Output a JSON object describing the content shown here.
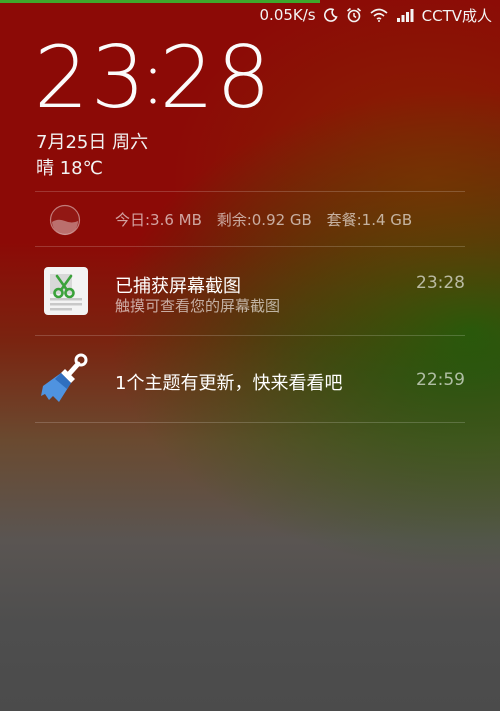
{
  "status_bar": {
    "network_speed": "0.05K/s",
    "moon_icon": "moon-icon",
    "alarm_icon": "alarm-clock-icon",
    "wifi_icon": "wifi-icon",
    "signal_icon": "signal-bars-icon",
    "carrier": "CCTV成人"
  },
  "lock_screen": {
    "clock_hours": "23",
    "clock_minutes": "28",
    "date": "7月25日 周六",
    "weather": "晴 18℃"
  },
  "memory": {
    "today_label": "今日:3.6 MB",
    "remaining_label": "剩余:0.92 GB",
    "plan_label": "套餐:1.4 GB",
    "gauge_icon": "data-usage-gauge-icon"
  },
  "notifications": [
    {
      "title": "已捕获屏幕截图",
      "subtitle": "触摸可查看您的屏幕截图",
      "time": "23:28",
      "icon": "screenshot-scissors-icon"
    },
    {
      "title": "1个主题有更新，快来看看吧",
      "time": "22:59",
      "icon": "theme-brush-icon"
    }
  ],
  "colors": {
    "background_top": "#8c0a06",
    "background_green": "#18600c",
    "background_bottom": "#4b4b4b",
    "progress_green": "#3ea82c"
  }
}
